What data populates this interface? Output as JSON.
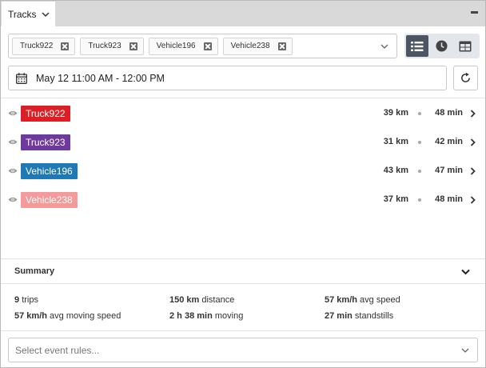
{
  "header": {
    "tab_label": "Tracks"
  },
  "filters": {
    "tags": [
      "Truck922",
      "Truck923",
      "Vehicle196",
      "Vehicle238"
    ]
  },
  "view_modes": [
    "list-icon",
    "clock-icon",
    "table-icon"
  ],
  "date_range": {
    "value": "May 12 11:00 AM - 12:00 PM"
  },
  "tracks": [
    {
      "name": "Truck922",
      "color": "#dc1f25",
      "distance": "39 km",
      "duration": "48 min"
    },
    {
      "name": "Truck923",
      "color": "#6f3a9d",
      "distance": "31 km",
      "duration": "42 min"
    },
    {
      "name": "Vehicle196",
      "color": "#1f79b4",
      "distance": "43 km",
      "duration": "47 min"
    },
    {
      "name": "Vehicle238",
      "color": "#f49a9b",
      "distance": "37 km",
      "duration": "48 min"
    }
  ],
  "summary": {
    "title": "Summary",
    "stats": [
      {
        "value": "9",
        "label": "trips"
      },
      {
        "value": "150 km",
        "label": "distance"
      },
      {
        "value": "57 km/h",
        "label": "avg speed"
      },
      {
        "value": "57 km/h",
        "label": "avg moving speed"
      },
      {
        "value": "2 h 38 min",
        "label": "moving"
      },
      {
        "value": "27 min",
        "label": "standstills"
      }
    ]
  },
  "event_rules": {
    "placeholder": "Select event rules..."
  }
}
